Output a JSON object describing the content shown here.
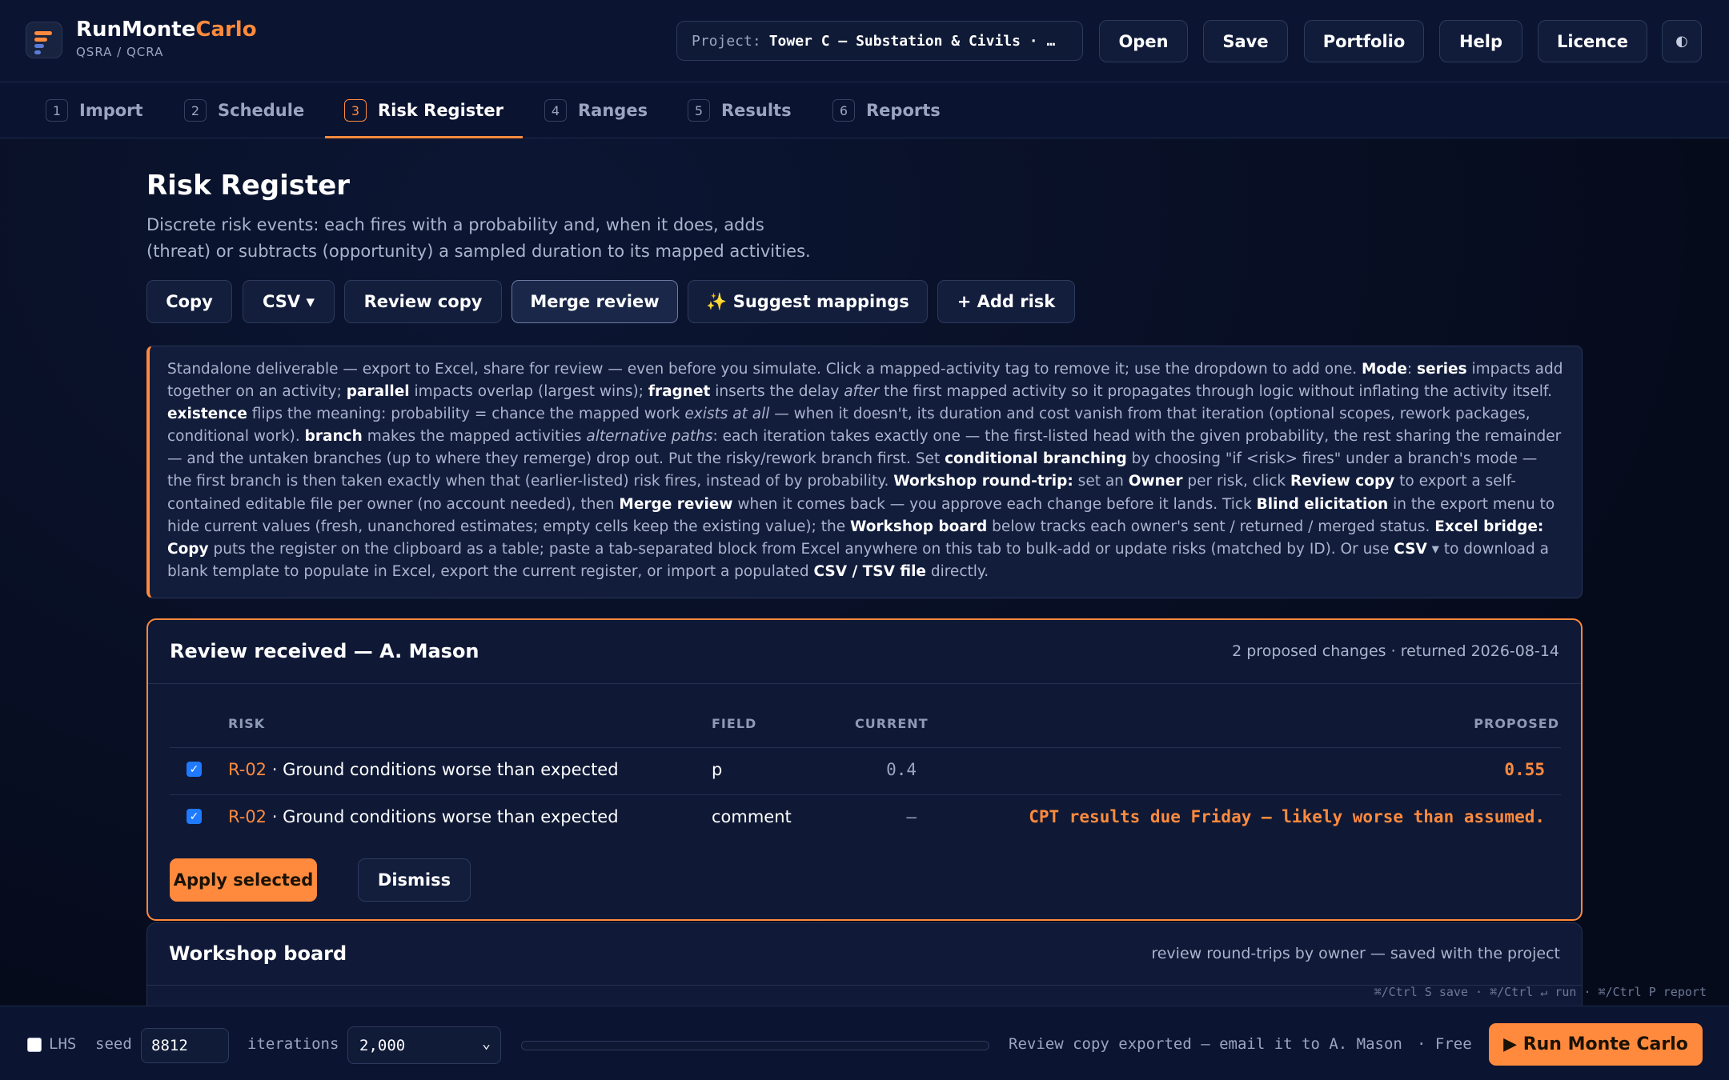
{
  "brand": {
    "name_main": "RunMonte",
    "name_accent": "Carlo",
    "subtitle": "QSRA / QCRA"
  },
  "header": {
    "project_label": "Project:",
    "project_value": "Tower C — Substation & Civils · …",
    "buttons": [
      "Open",
      "Save",
      "Portfolio",
      "Help",
      "Licence"
    ],
    "theme_icon": "half-moon-icon"
  },
  "tabs": [
    {
      "num": "1",
      "label": "Import"
    },
    {
      "num": "2",
      "label": "Schedule"
    },
    {
      "num": "3",
      "label": "Risk Register",
      "active": true
    },
    {
      "num": "4",
      "label": "Ranges"
    },
    {
      "num": "5",
      "label": "Results"
    },
    {
      "num": "6",
      "label": "Reports"
    }
  ],
  "page": {
    "title": "Risk Register",
    "desc_line1": "Discrete risk events: each fires with a probability and, when it does, adds",
    "desc_line2": "(threat) or subtracts (opportunity) a sampled duration to its mapped activities."
  },
  "actions": {
    "copy": "Copy",
    "csv": "CSV ▾",
    "review_copy": "Review copy",
    "merge_review": "Merge review",
    "suggest_mappings": "✨ Suggest mappings",
    "add_risk": "+ Add risk"
  },
  "info": {
    "s1": "Standalone deliverable — export to Excel, share for review — even before you simulate. Click a mapped-activity tag to remove it; use the dropdown to add one. ",
    "b_mode": "Mode",
    "s2": ": ",
    "b_series": "series",
    "s3": " impacts add together on an activity; ",
    "b_parallel": "parallel",
    "s4": " impacts overlap (largest wins); ",
    "b_fragnet": "fragnet",
    "s5": " inserts the delay ",
    "i_after": "after",
    "s6": " the first mapped activity so it propagates through logic without inflating the activity itself. ",
    "b_existence": "existence",
    "s7": " flips the meaning: probability = chance the mapped work ",
    "i_exists": "exists at all",
    "s8": " — when it doesn't, its duration and cost vanish from that iteration (optional scopes, rework packages, conditional work). ",
    "b_branch": "branch",
    "s9": " makes the mapped activities ",
    "i_alt": "alternative paths",
    "s10": ": each iteration takes exactly one — the first-listed head with the given probability, the rest sharing the remainder — and the untaken branches (up to where they remerge) drop out. Put the risky/rework branch first. Set ",
    "b_cond": "conditional branching",
    "s11": " by choosing \"if <risk> fires\" under a branch's mode — the first branch is then taken exactly when that (earlier-listed) risk fires, instead of by probability. ",
    "b_workshop": "Workshop round-trip:",
    "s12": " set an ",
    "b_owner": "Owner",
    "s13": " per risk, click ",
    "b_review": "Review copy",
    "s14": " to export a self-contained editable file per owner (no account needed), then ",
    "b_merge": "Merge review",
    "s15": " when it comes back — you approve each change before it lands. Tick ",
    "b_blind": "Blind elicitation",
    "s16": " in the export menu to hide current values (fresh, unanchored estimates; empty cells keep the existing value); the ",
    "b_board": "Workshop board",
    "s17": " below tracks each owner's sent / returned / merged status. ",
    "b_excel": "Excel bridge: Copy",
    "s18": " puts the register on the clipboard as a table; paste a tab-separated block from Excel anywhere on this tab to bulk-add or update risks (matched by ID). Or use ",
    "b_csv": "CSV",
    "s19": " ▾ to download a blank template to populate in Excel, export the current register, or import a populated ",
    "b_csvfile": "CSV / TSV file",
    "s20": " directly."
  },
  "review": {
    "title": "Review received — A. Mason",
    "meta": "2 proposed changes · returned 2026-08-14",
    "headers": {
      "risk": "RISK",
      "field": "FIELD",
      "current": "CURRENT",
      "proposed": "PROPOSED"
    },
    "rows": [
      {
        "checked": true,
        "id": "R-02",
        "name": " · Ground conditions worse than expected",
        "field": "p",
        "current": "0.4",
        "proposed": "0.55"
      },
      {
        "checked": true,
        "id": "R-02",
        "name": " · Ground conditions worse than expected",
        "field": "comment",
        "current": "–",
        "proposed": "CPT results due Friday — likely worse than assumed."
      }
    ],
    "apply": "Apply selected",
    "dismiss": "Dismiss"
  },
  "workshop": {
    "title": "Workshop board",
    "meta": "review round-trips by owner — saved with the project"
  },
  "shortcuts": "⌘/Ctrl S save · ⌘/Ctrl ↵ run · ⌘/Ctrl P report",
  "bottom": {
    "lhs": "LHS",
    "seed_label": "seed",
    "seed_value": "8812",
    "iterations_label": "iterations",
    "iterations_value": "2,000",
    "progress": 0,
    "status": "Review copy exported — email it to A. Mason",
    "plan": "· Free",
    "run": "▶ Run Monte Carlo"
  },
  "colors": {
    "accent": "#ff8a3d",
    "background": "#060b1c",
    "checkbox": "#1f7aff"
  }
}
